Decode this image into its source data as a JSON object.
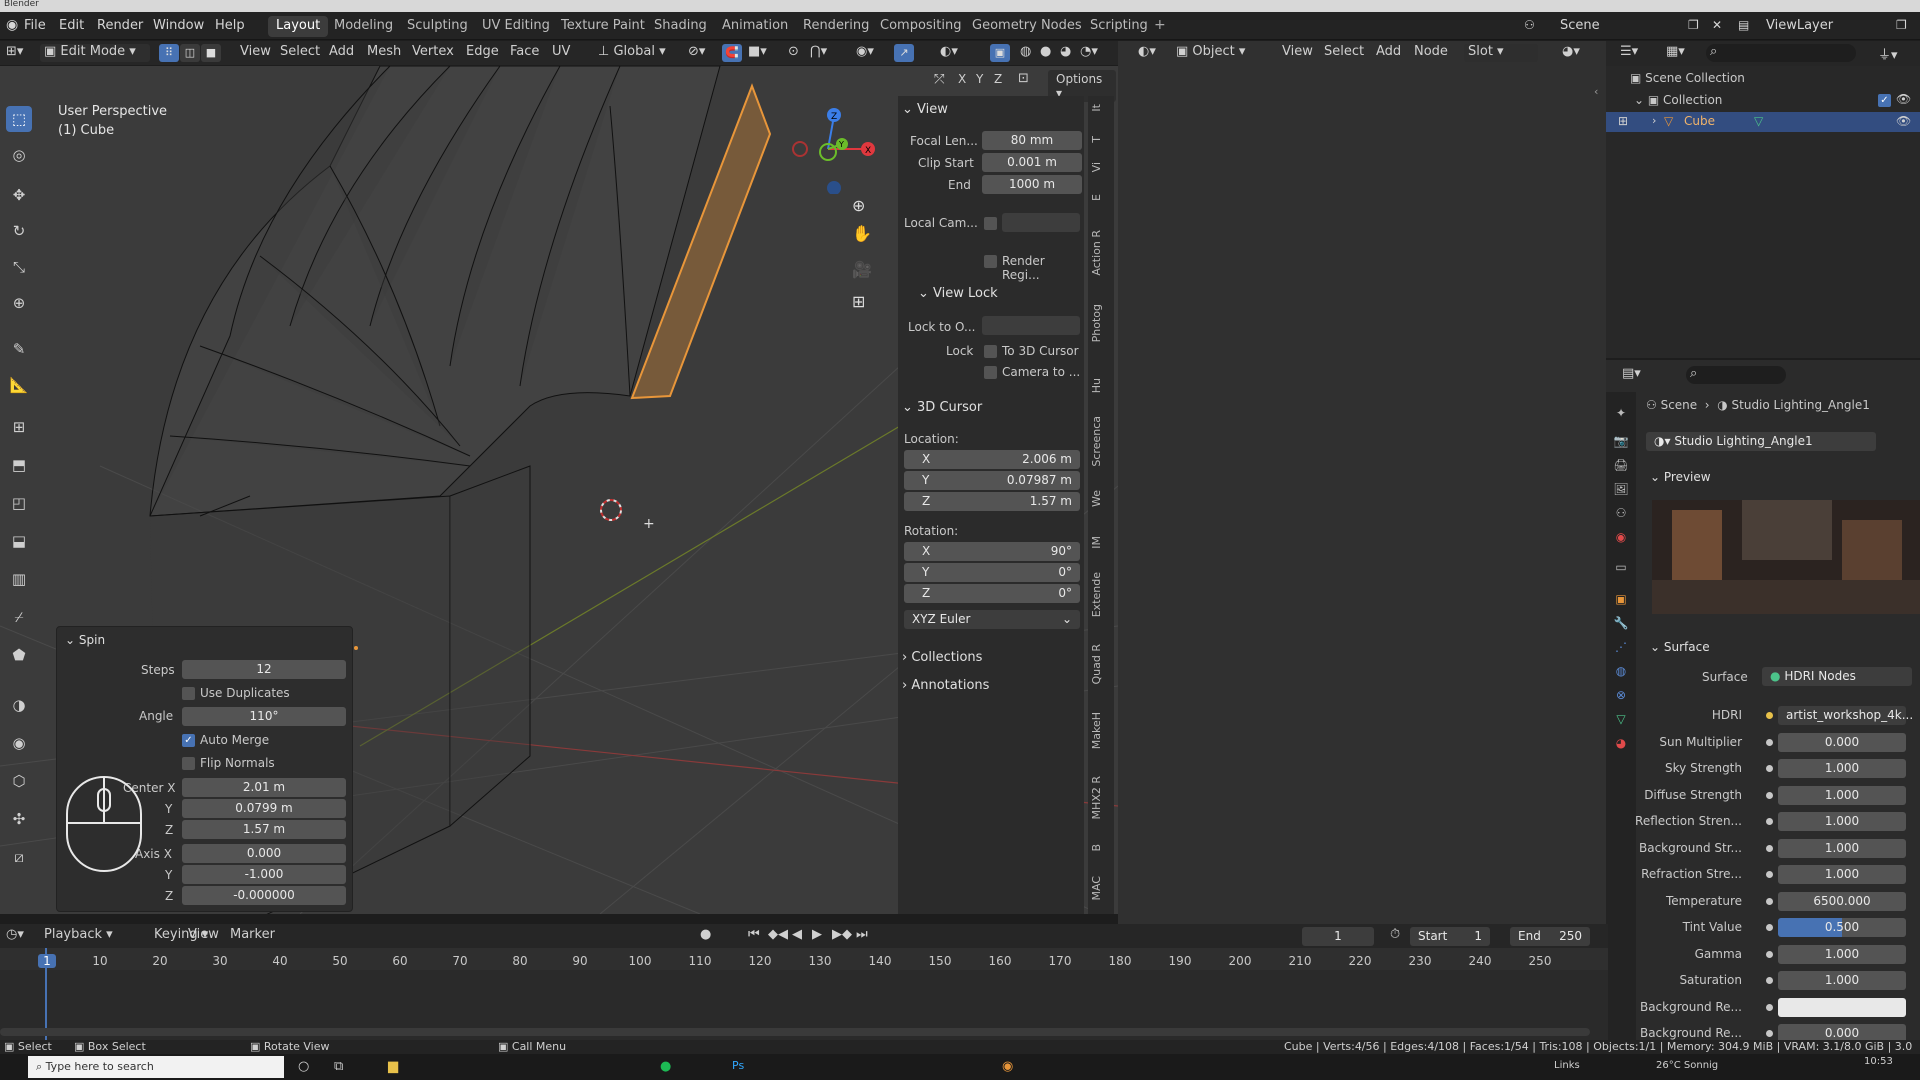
{
  "window": {
    "title": "Blender"
  },
  "menu": {
    "items": [
      "File",
      "Edit",
      "Render",
      "Window",
      "Help"
    ],
    "workspaces": [
      "Layout",
      "Modeling",
      "Sculpting",
      "UV Editing",
      "Texture Paint",
      "Shading",
      "Animation",
      "Rendering",
      "Compositing",
      "Geometry Nodes",
      "Scripting"
    ],
    "active_workspace": "Layout",
    "scene_label": "Scene",
    "view_layer_label": "ViewLayer"
  },
  "viewport_header": {
    "mode": "Edit Mode",
    "menus": [
      "View",
      "Select",
      "Add",
      "Mesh",
      "Vertex",
      "Edge",
      "Face",
      "UV"
    ],
    "transform_orientation": "Global",
    "options_label": "Options",
    "axes": [
      "X",
      "Y",
      "Z"
    ]
  },
  "viewport": {
    "overlay_title": "User Perspective",
    "overlay_object": "(1) Cube",
    "gizmo_axes": {
      "x": "X",
      "y": "Y",
      "z": "Z"
    }
  },
  "npanel": {
    "view_section": "View",
    "focal_label": "Focal Len...",
    "focal_value": "80 mm",
    "clip_start_label": "Clip Start",
    "clip_start_value": "0.001 m",
    "clip_end_label": "End",
    "clip_end_value": "1000 m",
    "local_cam_label": "Local Cam...",
    "render_region_label": "Render Regi...",
    "view_lock_section": "View Lock",
    "lock_to_label": "Lock to O...",
    "lock_label": "Lock",
    "to_cursor_label": "To 3D Cursor",
    "camera_to_label": "Camera to ...",
    "cursor_section": "3D Cursor",
    "location_label": "Location:",
    "loc_x_label": "X",
    "loc_x": "2.006 m",
    "loc_y_label": "Y",
    "loc_y": "0.07987 m",
    "loc_z_label": "Z",
    "loc_z": "1.57 m",
    "rotation_label": "Rotation:",
    "rot_x_label": "X",
    "rot_x": "90°",
    "rot_y_label": "Y",
    "rot_y": "0°",
    "rot_z_label": "Z",
    "rot_z": "0°",
    "rotation_mode": "XYZ Euler",
    "collections_section": "Collections",
    "annotations_section": "Annotations",
    "side_tabs": [
      "It",
      "T",
      "Vi",
      "E",
      "Action R",
      "Photog",
      "Hu",
      "Screenca",
      "We",
      "IM",
      "Extende",
      "Quad R",
      "MakeH",
      "MHX2 R",
      "B",
      "MAC"
    ]
  },
  "spin": {
    "title": "Spin",
    "steps_label": "Steps",
    "steps": "12",
    "use_duplicates": "Use Duplicates",
    "angle_label": "Angle",
    "angle": "110°",
    "auto_merge": "Auto Merge",
    "flip_normals": "Flip Normals",
    "center_x_label": "Center X",
    "center_x": "2.01 m",
    "center_y_label": "Y",
    "center_y": "0.0799 m",
    "center_z_label": "Z",
    "center_z": "1.57 m",
    "axis_x_label": "Axis X",
    "axis_x": "0.000",
    "axis_y_label": "Y",
    "axis_y": "-1.000",
    "axis_z_label": "Z",
    "axis_z": "-0.000000"
  },
  "shader_editor": {
    "object_mode": "Object",
    "menus": [
      "View",
      "Select",
      "Add",
      "Node"
    ],
    "slot": "Slot"
  },
  "outliner": {
    "scene_collection": "Scene Collection",
    "collection": "Collection",
    "cube": "Cube"
  },
  "properties": {
    "breadcrumb_scene": "Scene",
    "breadcrumb_world": "Studio Lighting_Angle1",
    "world_name": "Studio Lighting_Angle1",
    "preview_section": "Preview",
    "surface_section": "Surface",
    "surface_label": "Surface",
    "surface_value": "HDRI Nodes",
    "rows": [
      {
        "label": "HDRI",
        "value": "artist_workshop_4k..."
      },
      {
        "label": "Sun Multiplier",
        "value": "0.000"
      },
      {
        "label": "Sky Strength",
        "value": "1.000"
      },
      {
        "label": "Diffuse Strength",
        "value": "1.000"
      },
      {
        "label": "Reflection Stren...",
        "value": "1.000"
      },
      {
        "label": "Background Str...",
        "value": "1.000"
      },
      {
        "label": "Refraction Stre...",
        "value": "1.000"
      },
      {
        "label": "Temperature",
        "value": "6500.000"
      },
      {
        "label": "Tint Value",
        "value": "0.500"
      },
      {
        "label": "Gamma",
        "value": "1.000"
      },
      {
        "label": "Saturation",
        "value": "1.000"
      },
      {
        "label": "Background Re...",
        "value": ""
      },
      {
        "label": "Background Re...",
        "value": "0.000"
      }
    ],
    "tint_fraction": 0.5
  },
  "timeline": {
    "menus": [
      "Playback",
      "Keying",
      "View",
      "Marker"
    ],
    "current_frame": "1",
    "start_label": "Start",
    "start": "1",
    "end_label": "End",
    "end": "250",
    "frames": [
      "1",
      "10",
      "20",
      "30",
      "40",
      "50",
      "60",
      "70",
      "80",
      "90",
      "100",
      "110",
      "120",
      "130",
      "140",
      "150",
      "160",
      "170",
      "180",
      "190",
      "200",
      "210",
      "220",
      "230",
      "240",
      "250"
    ]
  },
  "statusbar": {
    "select": "Select",
    "box_select": "Box Select",
    "rotate_view": "Rotate View",
    "call_menu": "Call Menu",
    "stats": "Cube | Verts:4/56 | Edges:4/108 | Faces:1/54 | Tris:108 | Objects:1/1 | Memory: 304.9 MiB | VRAM: 3.1/8.0 GiB | 3.0"
  },
  "taskbar": {
    "search_placeholder": "Type here to search",
    "links": "Links",
    "weather": "26°C Sonnig",
    "time": "10:53"
  },
  "colors": {
    "accent": "#4772b3",
    "selected_orange": "#e8963a",
    "header": "#232323"
  }
}
